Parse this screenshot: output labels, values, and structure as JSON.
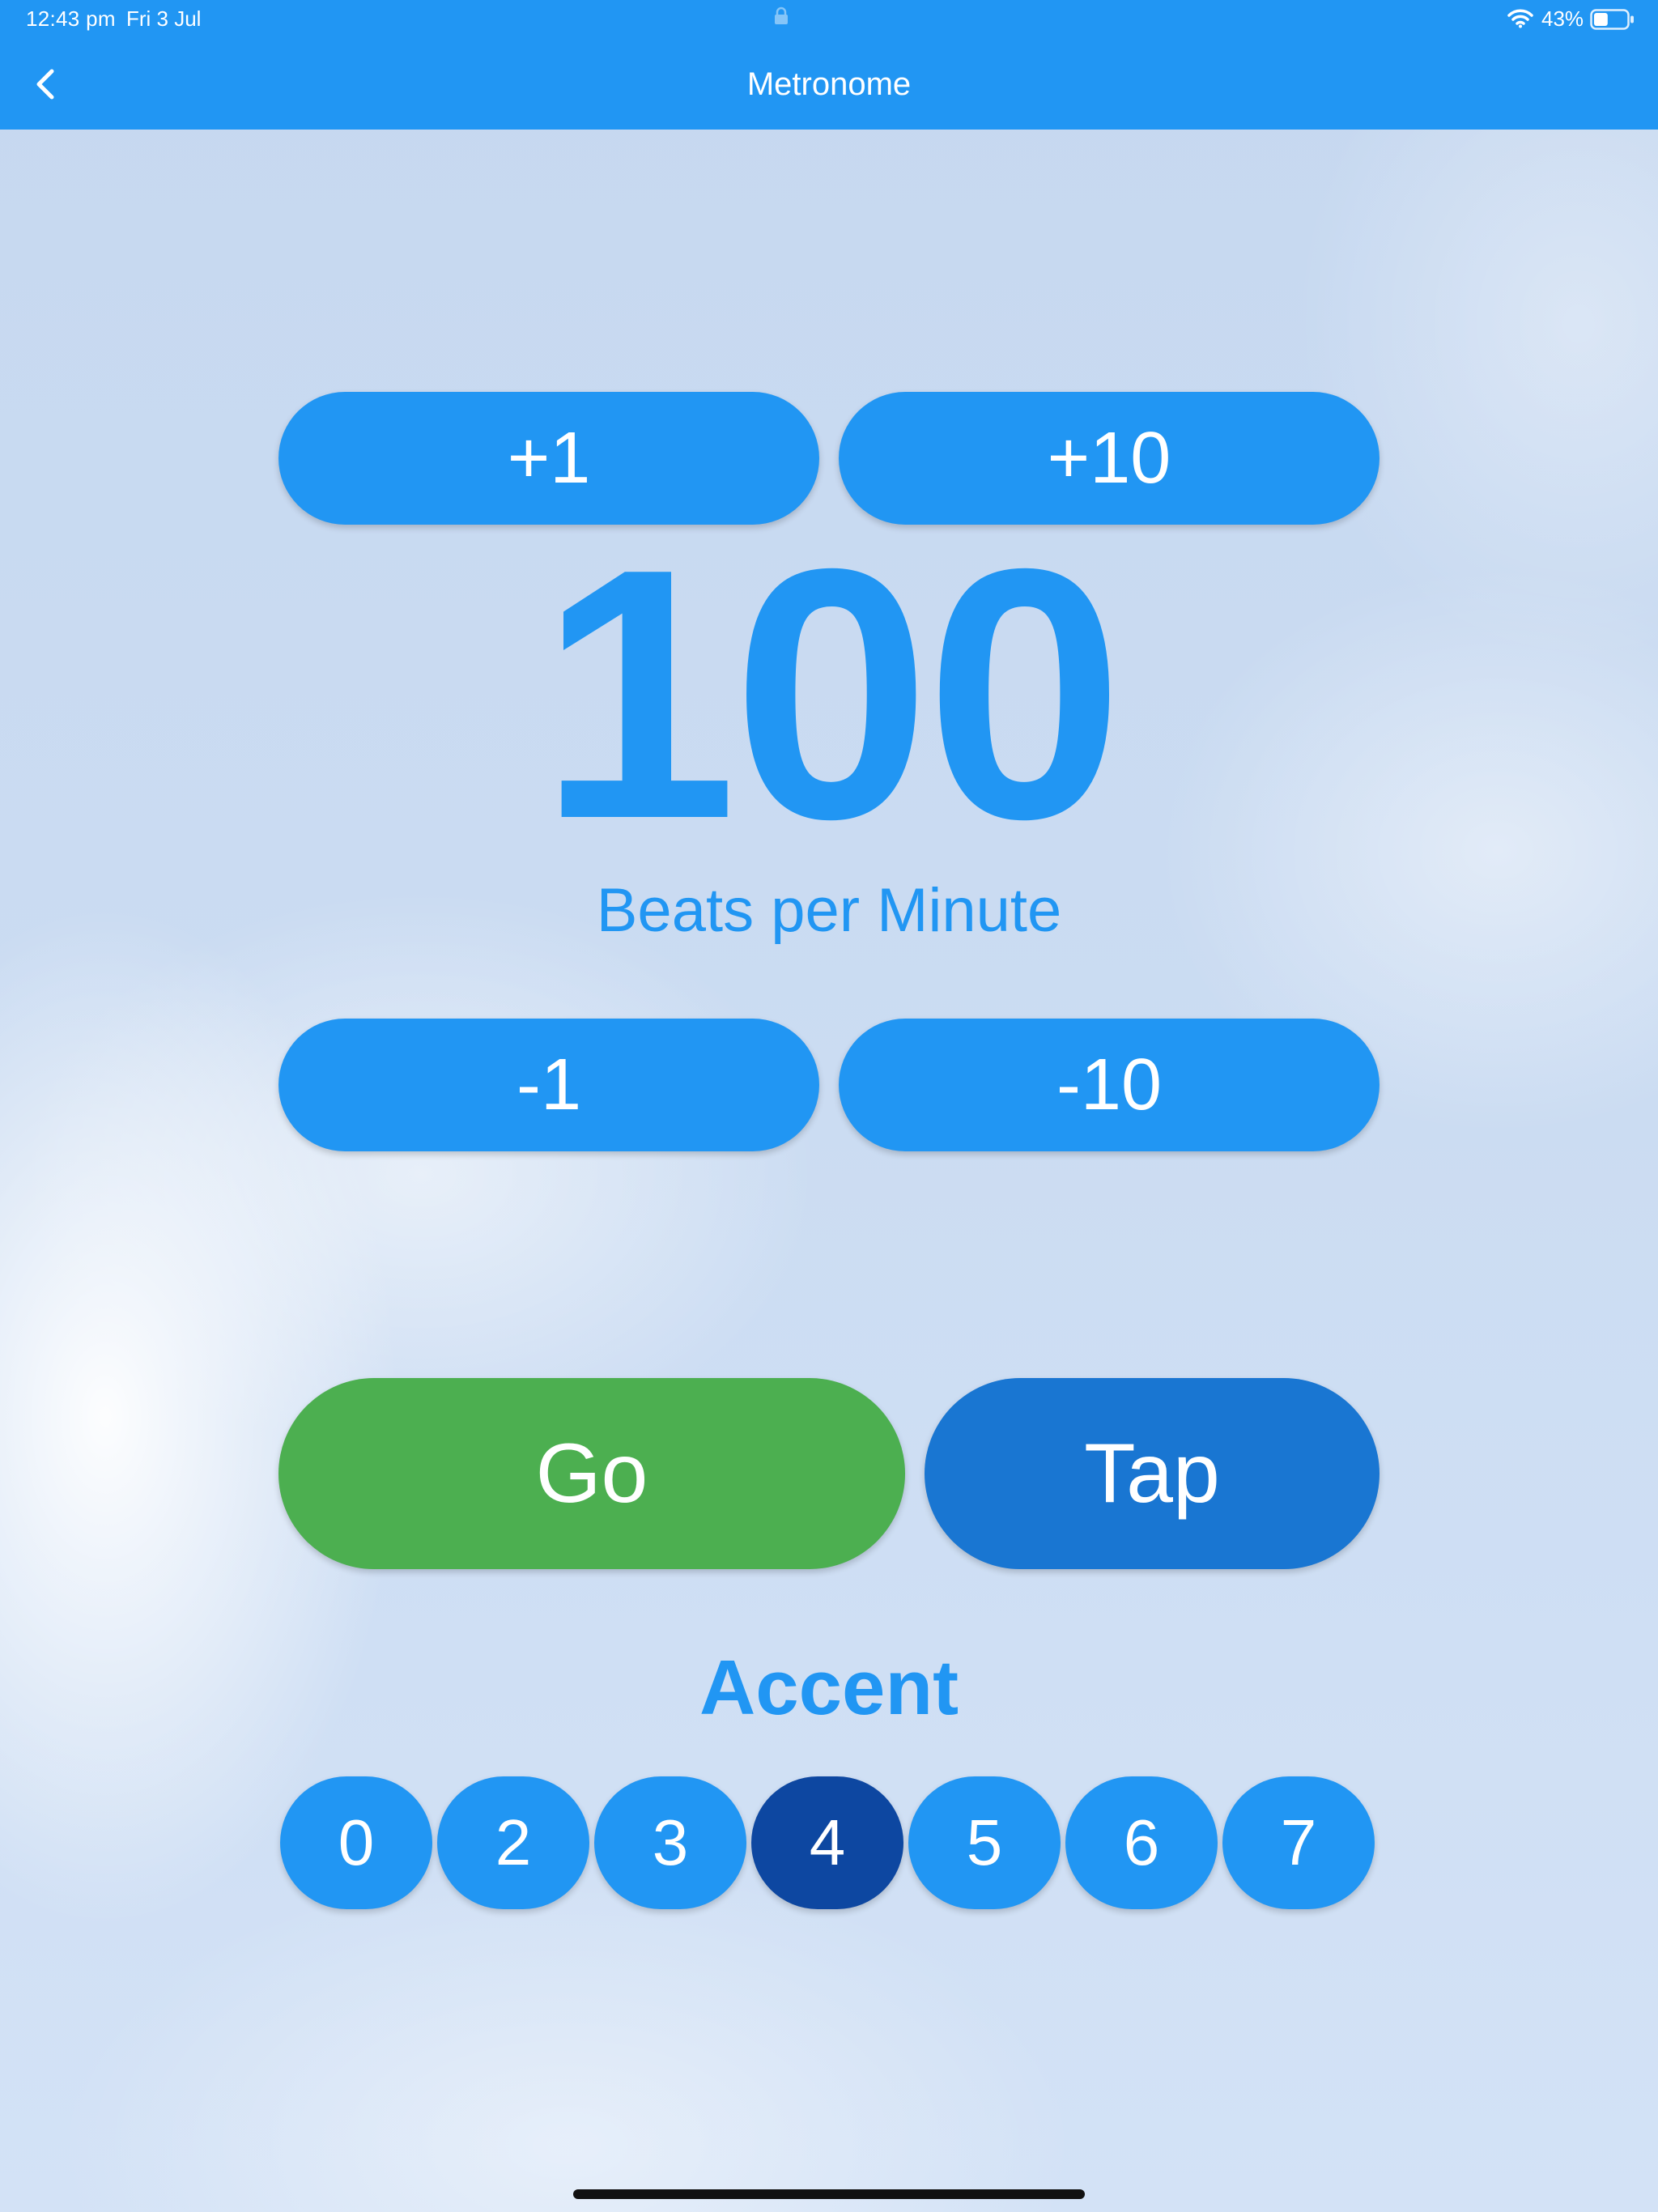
{
  "status_bar": {
    "time": "12:43 pm",
    "date": "Fri 3 Jul",
    "battery_percent": "43%",
    "battery_level": 0.43
  },
  "nav": {
    "title": "Metronome",
    "back_icon": "chevron-left-icon"
  },
  "tempo": {
    "plus_one": "+1",
    "plus_ten": "+10",
    "bpm": "100",
    "label": "Beats per Minute",
    "minus_one": "-1",
    "minus_ten": "-10"
  },
  "controls": {
    "go": "Go",
    "tap": "Tap"
  },
  "accent": {
    "heading": "Accent",
    "options": [
      "0",
      "2",
      "3",
      "4",
      "5",
      "6",
      "7"
    ],
    "selected": "4"
  },
  "colors": {
    "primary": "#2196f3",
    "go": "#4caf50",
    "tap": "#1976d2",
    "selected": "#0d47a1"
  }
}
